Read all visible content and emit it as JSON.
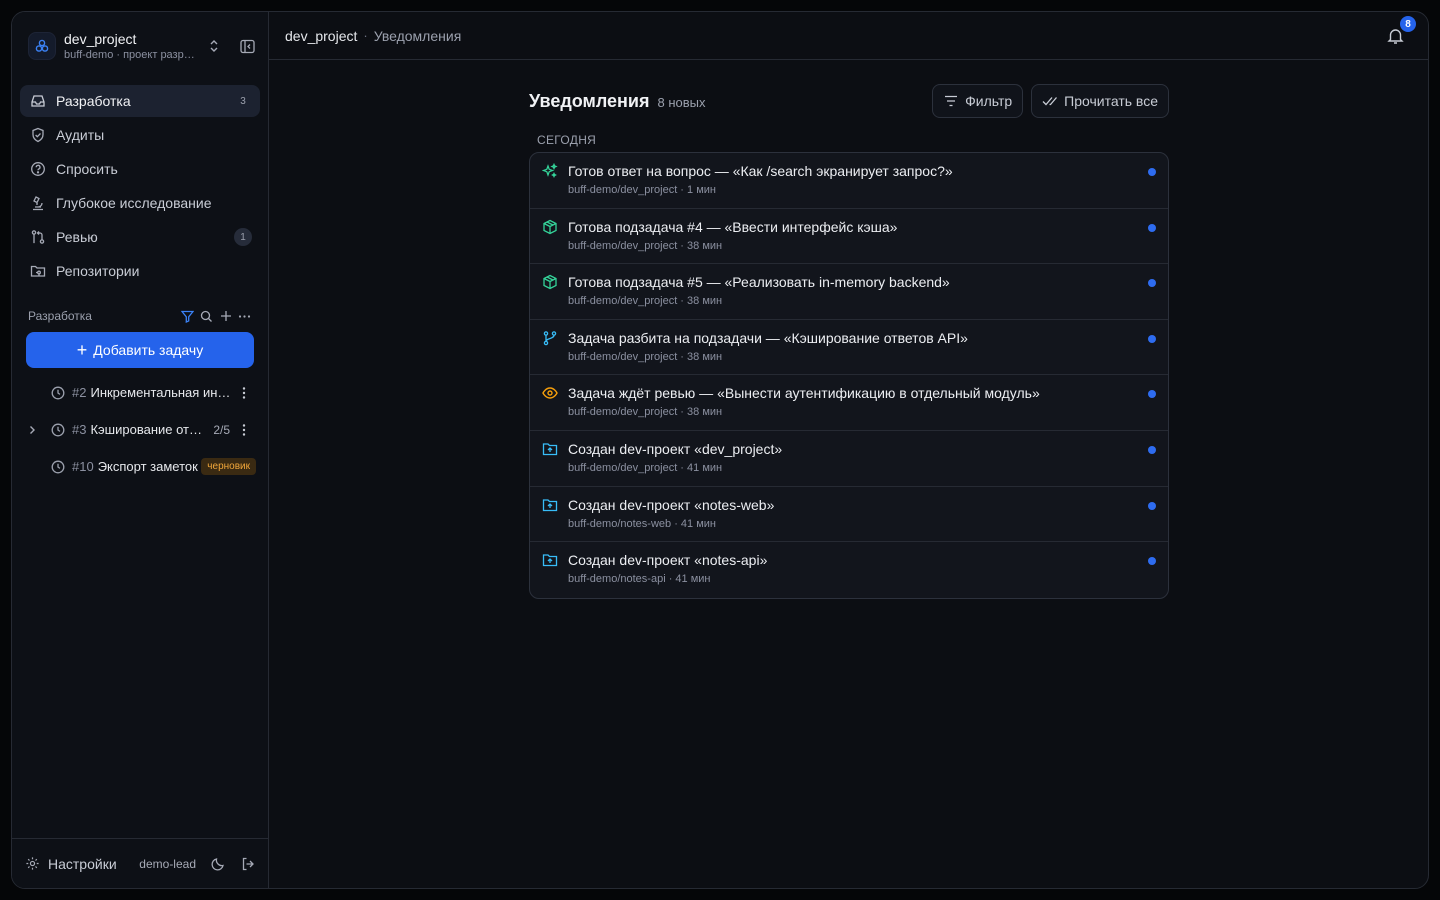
{
  "project": {
    "name": "dev_project",
    "subtitle": "buff-demo · проект разработки"
  },
  "nav": [
    {
      "label": "Разработка",
      "count": "3",
      "icon": "inbox-icon",
      "active": true
    },
    {
      "label": "Аудиты",
      "count": "",
      "icon": "shield-check-icon"
    },
    {
      "label": "Спросить",
      "count": "",
      "icon": "question-circle-icon"
    },
    {
      "label": "Глубокое исследование",
      "count": "",
      "icon": "microscope-icon"
    },
    {
      "label": "Ревью",
      "count": "1",
      "icon": "git-compare-icon"
    },
    {
      "label": "Репозитории",
      "count": "",
      "icon": "folder-git-icon"
    }
  ],
  "section": {
    "title": "Разработка",
    "add_label": "Добавить задачу"
  },
  "tasks": [
    {
      "num": "#2",
      "title": "Инкрементальная индексация",
      "progress": "",
      "draft": ""
    },
    {
      "num": "#3",
      "title": "Кэширование ответов API",
      "progress": "2/5",
      "draft": ""
    },
    {
      "num": "#10",
      "title": "Экспорт заметок",
      "progress": "",
      "draft": "черновик"
    }
  ],
  "footer": {
    "settings_label": "Настройки",
    "user": "demo-lead"
  },
  "topbar": {
    "project": "dev_project",
    "separator": "·",
    "current": "Уведомления",
    "badge": "8"
  },
  "notifications_page": {
    "title": "Уведомления",
    "count": "8 новых",
    "filter_label": "Фильтр",
    "read_all_label": "Прочитать все",
    "group_label": "СЕГОДНЯ"
  },
  "notifications": [
    {
      "icon": "sparkles-icon",
      "color": "#34d399",
      "title": "Готов ответ на вопрос — «Как /search экранирует запрос?»",
      "sub": "buff-demo/dev_project · 1 мин"
    },
    {
      "icon": "package-icon",
      "color": "#34d399",
      "title": "Готова подзадача #4 — «Ввести интерфейс кэша»",
      "sub": "buff-demo/dev_project · 38 мин"
    },
    {
      "icon": "package-icon",
      "color": "#34d399",
      "title": "Готова подзадача #5 — «Реализовать in-memory backend»",
      "sub": "buff-demo/dev_project · 38 мин"
    },
    {
      "icon": "git-branch-icon",
      "color": "#38bdf8",
      "title": "Задача разбита на подзадачи — «Кэширование ответов API»",
      "sub": "buff-demo/dev_project · 38 мин"
    },
    {
      "icon": "eye-icon",
      "color": "#f59e0b",
      "title": "Задача ждёт ревью — «Вынести аутентификацию в отдельный модуль»",
      "sub": "buff-demo/dev_project · 38 мин"
    },
    {
      "icon": "folder-plus-icon",
      "color": "#38bdf8",
      "title": "Создан dev-проект «dev_project»",
      "sub": "buff-demo/dev_project · 41 мин"
    },
    {
      "icon": "folder-plus-icon",
      "color": "#38bdf8",
      "title": "Создан dev-проект «notes-web»",
      "sub": "buff-demo/notes-web · 41 мин"
    },
    {
      "icon": "folder-plus-icon",
      "color": "#38bdf8",
      "title": "Создан dev-проект «notes-api»",
      "sub": "buff-demo/notes-api · 41 мин"
    }
  ],
  "colors": {
    "accent": "#2563eb",
    "unread_dot": "#2e6cf0",
    "draft": "#f0a63a"
  }
}
